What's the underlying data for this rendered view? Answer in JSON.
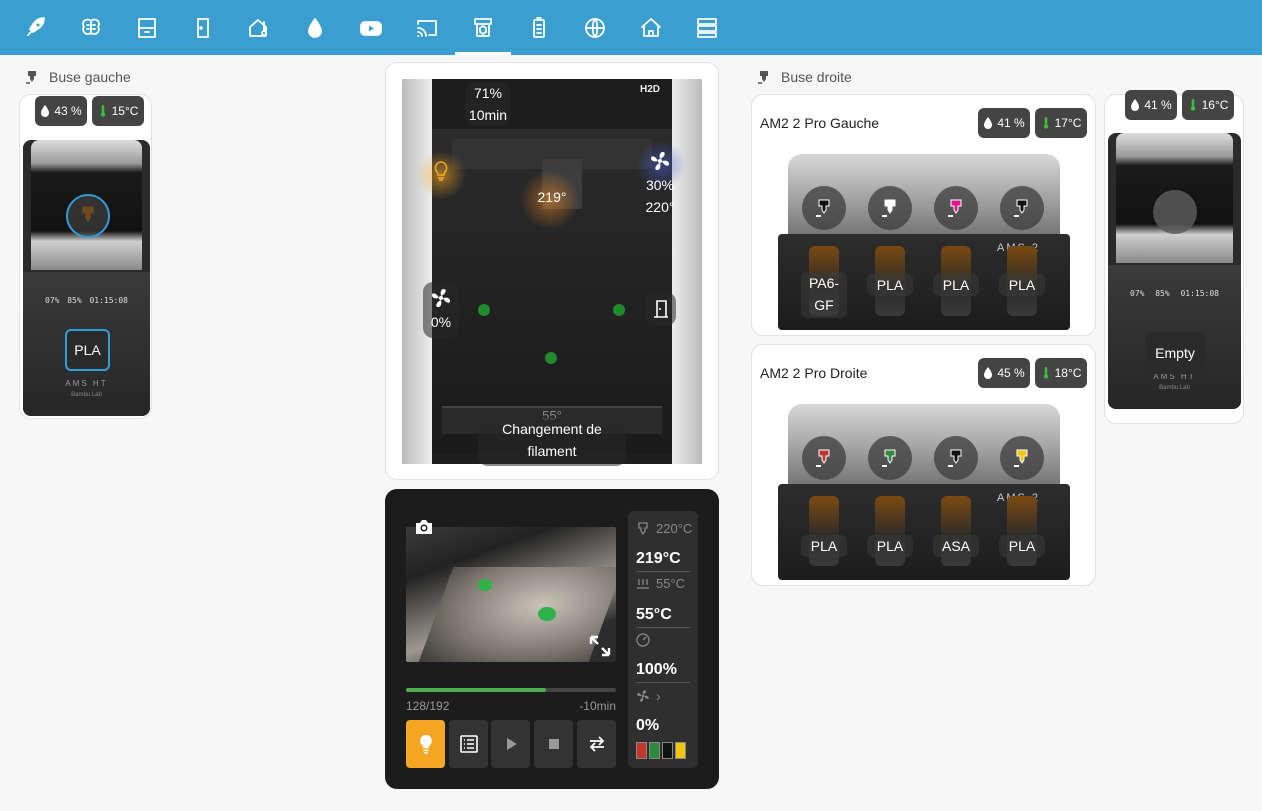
{
  "nav": {
    "items": [
      "rocket-icon",
      "brain-icon",
      "printer-bed-icon",
      "door-icon",
      "home-thermometer-icon",
      "water-drop-icon",
      "youtube-icon",
      "cast-icon",
      "printer-3d-icon",
      "battery-icon",
      "globe-icon",
      "home-outline-icon",
      "server-icon"
    ],
    "active_index": 8
  },
  "left": {
    "title": "Buse gauche",
    "humidity": "43 %",
    "temperature": "15°C",
    "screen": [
      "07%",
      "85%",
      "01:15:08"
    ],
    "filament": "PLA",
    "brand": "AMS HT",
    "brand_sub": "Bambu Lab"
  },
  "printer": {
    "model": "H2D",
    "chamber_pct": "71%",
    "chamber_time": "10min",
    "nozzle_temp": "219°",
    "fan_pct": "30%",
    "fan_temp": "220°",
    "aux_fan_pct": "0%",
    "bed_temp": "55°",
    "status": "Changement de filament"
  },
  "control": {
    "progress_layers": "128/192",
    "remaining": "-10min",
    "progress_fraction": 0.667,
    "nozzle_target": "220°C",
    "nozzle_current": "219°C",
    "bed_target": "55°C",
    "bed_current": "55°C",
    "speed": "100%",
    "fan": "0%",
    "filament_colors": [
      "#c0392b",
      "#2e8b3e",
      "#111111",
      "#f1c40f"
    ],
    "light_color": "#f5a623"
  },
  "right": {
    "title": "Buse droite",
    "ams1": {
      "name": "AM2 2 Pro Gauche",
      "humidity": "41 %",
      "temperature": "17°C",
      "brand": "AMS 2",
      "slots": [
        {
          "label": "PA6-GF",
          "color": "#111111"
        },
        {
          "label": "PLA",
          "color": "#ffffff"
        },
        {
          "label": "PLA",
          "color": "#e0158f"
        },
        {
          "label": "PLA",
          "color": "#111111"
        }
      ]
    },
    "ams2": {
      "name": "AM2 2 Pro Droite",
      "humidity": "45 %",
      "temperature": "18°C",
      "brand": "AMS 2",
      "slots": [
        {
          "label": "PLA",
          "color": "#c0392b"
        },
        {
          "label": "PLA",
          "color": "#2e8b3e"
        },
        {
          "label": "ASA",
          "color": "#111111"
        },
        {
          "label": "PLA",
          "color": "#f1c40f"
        }
      ]
    },
    "ht": {
      "humidity": "41 %",
      "temperature": "16°C",
      "screen": [
        "07%",
        "85%",
        "01:15:08"
      ],
      "filament": "Empty",
      "brand": "AMS HT",
      "brand_sub": "Bambu Lab"
    }
  }
}
